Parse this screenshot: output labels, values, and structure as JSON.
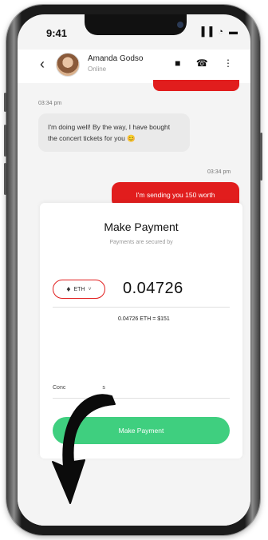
{
  "status_bar": {
    "time": "9:41",
    "icons": "▐▐ ◔ ▬"
  },
  "header": {
    "back_icon": "chevron-left-icon",
    "back_glyph": "‹",
    "contact_name": "Amanda Godso",
    "contact_status": "Online",
    "actions_glyphs": "■ ☎ ⋮"
  },
  "messages": {
    "incoming_time": "03:34 pm",
    "incoming_text": "I'm doing well! By the way, I have bought the concert tickets for you 😊",
    "outgoing_time": "03:34 pm",
    "outgoing_text": "I'm sending you 150 worth"
  },
  "close_label": "×",
  "payment": {
    "title": "Make Payment",
    "subtitle": "Payments are secured by",
    "token": "ETH",
    "token_icon_glyph": "♦",
    "chevron_glyph": "˅",
    "amount": "0.04726",
    "conversion": "0.04726 ETH = $151",
    "field_label": "Conc",
    "field_label_tail": "s",
    "button_label": "Make Payment"
  },
  "colors": {
    "accent_red": "#e11d1d",
    "pay_green": "#3fcf7f"
  }
}
